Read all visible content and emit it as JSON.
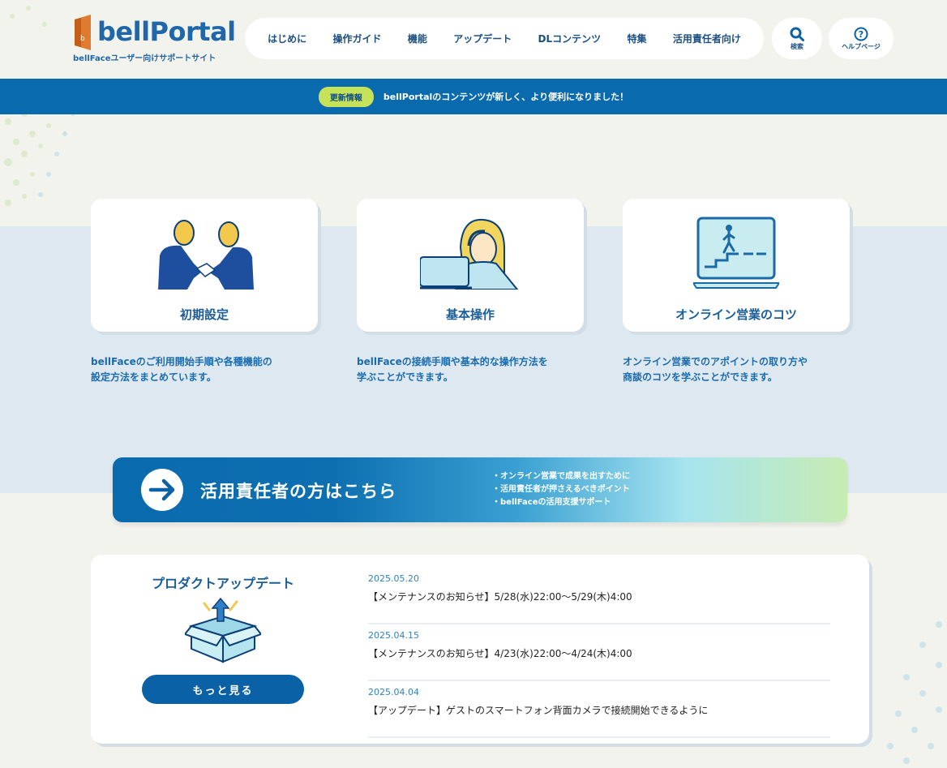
{
  "brand": {
    "name": "bellPortal",
    "subtitle": "bellFaceユーザー向けサポートサイト",
    "primary_color": "#0a6aae",
    "accent_color": "#c6e25b"
  },
  "nav": {
    "items": [
      {
        "label": "はじめに"
      },
      {
        "label": "操作ガイド"
      },
      {
        "label": "機能"
      },
      {
        "label": "アップデート"
      },
      {
        "label": "DLコンテンツ"
      },
      {
        "label": "特集"
      },
      {
        "label": "活用責任者向け"
      }
    ],
    "search_label": "検索",
    "search_icon": "search-icon",
    "help_label": "ヘルプページ",
    "help_icon": "question-circle-icon"
  },
  "announcement": {
    "badge": "更新情報",
    "text": "bellPortalのコンテンツが新しく、より便利になりました！"
  },
  "cards": [
    {
      "title": "初期設定",
      "desc_line1": "bellFaceのご利用開始手順や各種機能の",
      "desc_line2": "設定方法をまとめています。",
      "icon": "handshake-illustration"
    },
    {
      "title": "基本操作",
      "desc_line1": "bellFaceの接続手順や基本的な操作方法を",
      "desc_line2": "学ぶことができます。",
      "icon": "operator-laptop-illustration"
    },
    {
      "title": "オンライン営業のコツ",
      "desc_line1": "オンライン営業でのアポイントの取り方や",
      "desc_line2": "商談のコツを学ぶことができます。",
      "icon": "laptop-stairs-illustration"
    }
  ],
  "manager_banner": {
    "title": "活用責任者の方はこちら",
    "points": [
      "・オンライン営業で成果を出すために",
      "・活用責任者が押さえるべきポイント",
      "・bellFaceの活用支援サポート"
    ],
    "icon": "arrow-right-circle-icon"
  },
  "updates": {
    "title": "プロダクトアップデート",
    "more_label": "もっと見る",
    "icon": "box-update-illustration",
    "items": [
      {
        "date": "2025.05.20",
        "title": "【メンテナンスのお知らせ】5/28(水)22:00〜5/29(木)4:00"
      },
      {
        "date": "2025.04.15",
        "title": "【メンテナンスのお知らせ】4/23(水)22:00〜4/24(木)4:00"
      },
      {
        "date": "2025.04.04",
        "title": "【アップデート】ゲストのスマートフォン背面カメラで接続開始できるように"
      }
    ]
  }
}
